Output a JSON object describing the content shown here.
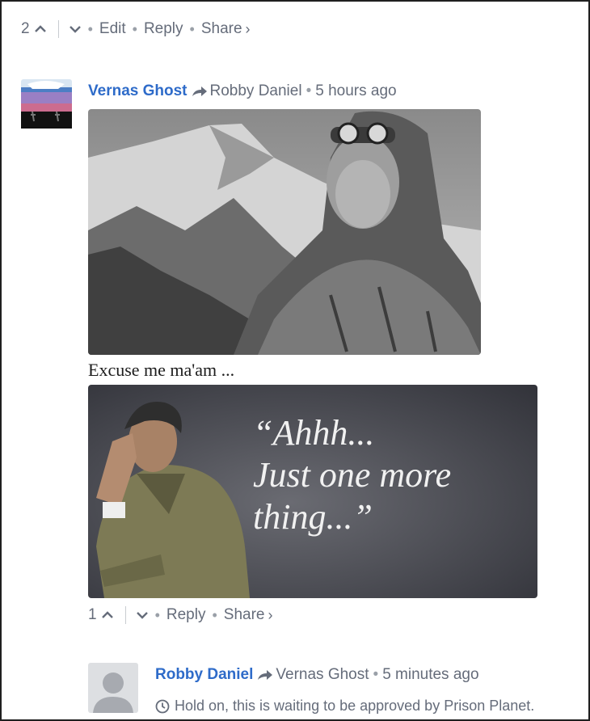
{
  "top_actions": {
    "count": "2",
    "edit": "Edit",
    "reply": "Reply",
    "share": "Share",
    "share_chevron": "›"
  },
  "comment": {
    "author": "Vernas Ghost",
    "parent": "Robby Daniel",
    "time": "5 hours ago",
    "caption": "Excuse me ma'am ...",
    "quote_lines": [
      "“Ahhh...",
      "Just one more",
      "thing...”"
    ],
    "actions": {
      "count": "1",
      "reply": "Reply",
      "share": "Share",
      "share_chevron": "›"
    }
  },
  "reply": {
    "author": "Robby Daniel",
    "parent": "Vernas Ghost",
    "time": "5 minutes ago",
    "pending": "Hold on, this is waiting to be approved by Prison Planet."
  },
  "icons": [
    "upvote-chevron-icon",
    "downvote-chevron-icon",
    "reply-arrow-icon",
    "clock-icon",
    "default-avatar-icon"
  ],
  "colors": {
    "author_link": "#2e6bc9",
    "meta_text": "#656c7a",
    "quote_panel": "#3a3b42"
  }
}
